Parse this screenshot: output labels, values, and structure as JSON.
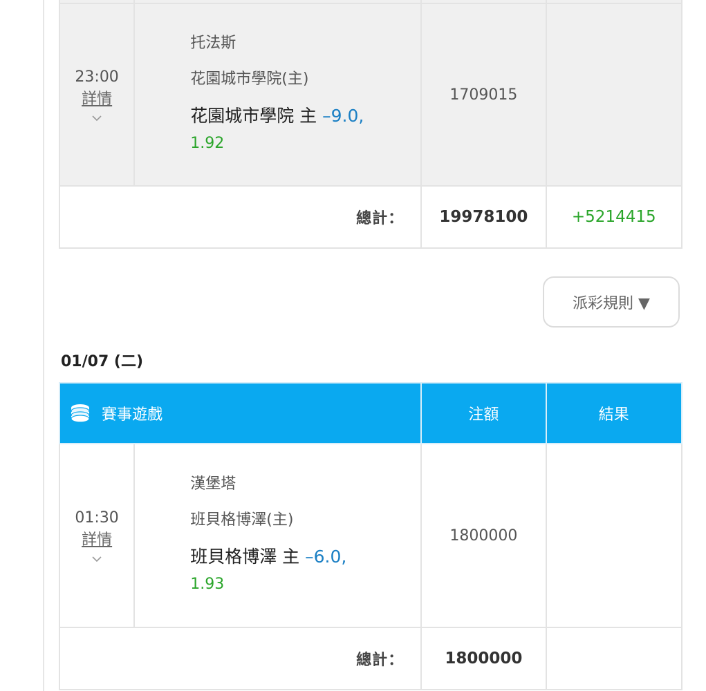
{
  "section1": {
    "bet": {
      "time": "23:00",
      "detail_label": "詳情",
      "league": "托法斯",
      "home_team": "花園城市學院(主)",
      "pick_team": "花園城市學院 主",
      "handicap": "–9.0,",
      "odds": "1.92",
      "amount": "1709015",
      "result": ""
    },
    "total": {
      "label": "總計：",
      "amount": "19978100",
      "result": "+5214415"
    }
  },
  "rules_button": {
    "label": "派彩規則 ▼"
  },
  "section2": {
    "date": "01/07 (二)",
    "headers": {
      "game": "賽事遊戲",
      "amount": "注額",
      "result": "結果"
    },
    "bet": {
      "time": "01:30",
      "detail_label": "詳情",
      "league": "漢堡塔",
      "home_team": "班貝格博澤(主)",
      "pick_team": "班貝格博澤 主",
      "handicap": "–6.0,",
      "odds": "1.93",
      "amount": "1800000",
      "result": ""
    },
    "total": {
      "label": "總計：",
      "amount": "1800000",
      "result": ""
    }
  },
  "colors": {
    "header_blue": "#0aa9f0",
    "handicap_blue": "#1a7fc4",
    "odds_green": "#2aa52a",
    "row_gray": "#f0f0f0"
  },
  "icons": {
    "chevron": "chevron-down-icon",
    "coins": "coins-stack-icon"
  }
}
